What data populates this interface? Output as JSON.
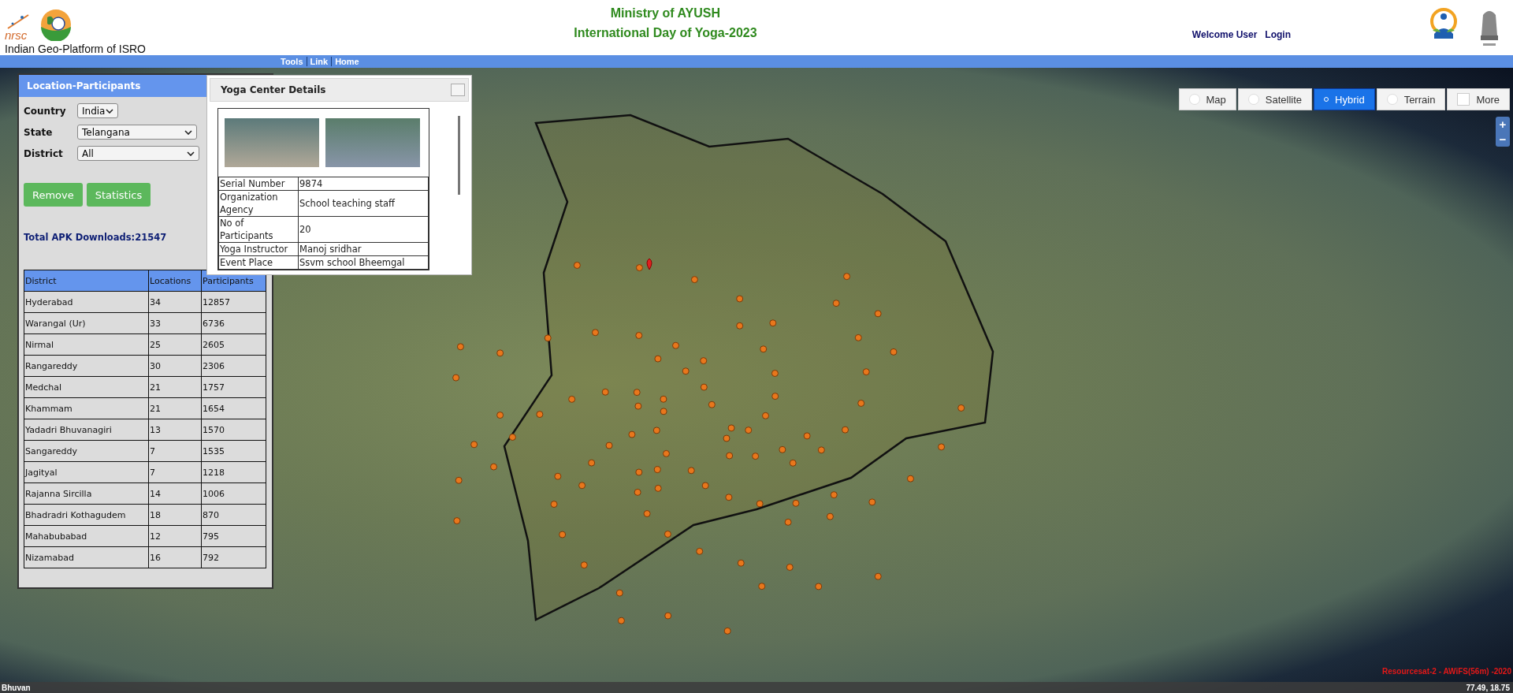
{
  "header": {
    "logo_text": "nrsc",
    "platform_title": "Indian Geo-Platform of ISRO",
    "title_lines": [
      "Ministry of AYUSH",
      "International Day of Yoga-2023"
    ],
    "user_links": [
      {
        "label": "Welcome User"
      },
      {
        "label": "Login"
      }
    ]
  },
  "nav": [
    {
      "label": "Tools"
    },
    {
      "label": "Link"
    },
    {
      "label": "Home"
    }
  ],
  "panel": {
    "title": "Location-Participants",
    "filters": [
      {
        "label": "Country",
        "value": "India"
      },
      {
        "label": "State",
        "value": "Telangana"
      },
      {
        "label": "District",
        "value": "All"
      }
    ],
    "buttons": [
      "Remove",
      "Statistics"
    ],
    "total_downloads": "Total APK Downloads:21547",
    "table": {
      "columns": [
        "District",
        "Locations",
        "Participants"
      ],
      "rows": [
        [
          "Hyderabad",
          "34",
          "12857"
        ],
        [
          "Warangal (Ur)",
          "33",
          "6736"
        ],
        [
          "Nirmal",
          "25",
          "2605"
        ],
        [
          "Rangareddy",
          "30",
          "2306"
        ],
        [
          "Medchal",
          "21",
          "1757"
        ],
        [
          "Khammam",
          "21",
          "1654"
        ],
        [
          "Yadadri Bhuvanagiri",
          "13",
          "1570"
        ],
        [
          "Sangareddy",
          "7",
          "1535"
        ],
        [
          "Jagityal",
          "7",
          "1218"
        ],
        [
          "Rajanna Sircilla",
          "14",
          "1006"
        ],
        [
          "Bhadradri Kothagudem",
          "18",
          "870"
        ],
        [
          "Mahabubabad",
          "12",
          "795"
        ],
        [
          "Nizamabad",
          "16",
          "792"
        ]
      ]
    }
  },
  "popup": {
    "title": "Yoga Center Details",
    "details": [
      {
        "label": "Serial Number",
        "value": "9874"
      },
      {
        "label": "Organization Agency",
        "value": "School teaching staff"
      },
      {
        "label": "No of Participants",
        "value": "20"
      },
      {
        "label": "Yoga Instructor",
        "value": "Manoj sridhar"
      },
      {
        "label": "Event Place",
        "value": "Ssvm school Bheemgal"
      }
    ]
  },
  "map_types": [
    {
      "label": "Map",
      "kind": "radio",
      "selected": false
    },
    {
      "label": "Satellite",
      "kind": "radio",
      "selected": false
    },
    {
      "label": "Hybrid",
      "kind": "radio",
      "selected": true
    },
    {
      "label": "Terrain",
      "kind": "radio",
      "selected": false
    },
    {
      "label": "More",
      "kind": "checkbox",
      "selected": false
    }
  ],
  "zoom_controls": [
    "+",
    "−"
  ],
  "imagery_credit": "Resourcesat-2 - AWiFS(56m) -2020",
  "status_bar": {
    "left": "Bhuvan",
    "coordinates": "77.49, 18.75"
  }
}
